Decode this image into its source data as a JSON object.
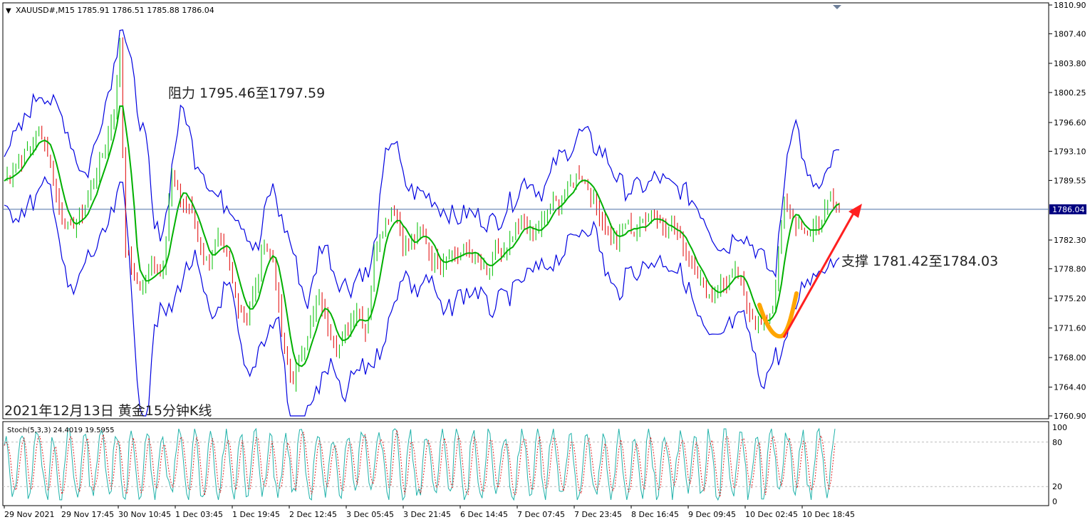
{
  "symbol_header": {
    "marker": "▼",
    "text": "XAUUSD#,M15  1785.91 1786.51 1785.88 1786.04"
  },
  "annotations": {
    "resistance": "阻力 1795.46至1797.59",
    "support": "支撑 1781.42至1784.03",
    "caption": "2021年12月13日 黄金15分钟K线"
  },
  "price_axis": {
    "ticks": [
      "1810.90",
      "1807.40",
      "1803.80",
      "1800.25",
      "1796.60",
      "1793.10",
      "1789.55",
      "1786.04",
      "1782.30",
      "1778.80",
      "1775.20",
      "1771.60",
      "1768.00",
      "1764.40",
      "1760.90"
    ],
    "current_price": "1786.04",
    "current_price_color": "#000080"
  },
  "stoch": {
    "label": "Stoch(5,3,3) 24.4019 19.5955",
    "levels": [
      "100",
      "80",
      "20",
      "0"
    ],
    "main_color": "#20b2aa",
    "signal_color": "#e02020"
  },
  "time_axis": {
    "labels": [
      "29 Nov 2021",
      "29 Nov 17:45",
      "30 Nov 10:45",
      "1 Dec 03:45",
      "1 Dec 19:45",
      "2 Dec 12:45",
      "3 Dec 05:45",
      "3 Dec 21:45",
      "6 Dec 14:45",
      "7 Dec 07:45",
      "7 Dec 23:45",
      "8 Dec 16:45",
      "9 Dec 09:45",
      "10 Dec 02:45",
      "10 Dec 18:45"
    ]
  },
  "colors": {
    "band": "#0000e0",
    "ma": "#00b000",
    "candle_up": "#00c000",
    "candle_down": "#e00000",
    "arrow": "#ff2020",
    "swing": "#ffa500",
    "axis_text": "#000000"
  },
  "chart_data": {
    "type": "candlestick",
    "title": "XAUUSD#,M15",
    "ylim": [
      1760.9,
      1810.9
    ],
    "path_close": [
      [
        0,
        1789.5
      ],
      [
        2,
        1792.5
      ],
      [
        4,
        1795.5
      ],
      [
        5,
        1791.5
      ],
      [
        6,
        1785.5
      ],
      [
        7,
        1783.5
      ],
      [
        8,
        1785
      ],
      [
        9,
        1787
      ],
      [
        10,
        1791
      ],
      [
        11,
        1794
      ],
      [
        12,
        1799.5
      ],
      [
        12.5,
        1807
      ],
      [
        13,
        1782
      ],
      [
        14,
        1777.5
      ],
      [
        15,
        1776.5
      ],
      [
        16,
        1779.5
      ],
      [
        17,
        1778
      ],
      [
        18,
        1790
      ],
      [
        19,
        1787
      ],
      [
        20,
        1786.5
      ],
      [
        21,
        1781.5
      ],
      [
        22,
        1779.5
      ],
      [
        23,
        1782.5
      ],
      [
        24,
        1780
      ],
      [
        25,
        1775
      ],
      [
        26,
        1773
      ],
      [
        27,
        1776
      ],
      [
        28,
        1782
      ],
      [
        29,
        1780
      ],
      [
        30,
        1769.5
      ],
      [
        31,
        1765
      ],
      [
        32,
        1768.5
      ],
      [
        33,
        1772
      ],
      [
        34,
        1775.5
      ],
      [
        35,
        1771.5
      ],
      [
        36,
        1769
      ],
      [
        37,
        1772
      ],
      [
        38,
        1774
      ],
      [
        39,
        1771
      ],
      [
        40,
        1782
      ],
      [
        41,
        1784.5
      ],
      [
        42,
        1786
      ],
      [
        43,
        1782
      ],
      [
        44,
        1781.5
      ],
      [
        45,
        1784
      ],
      [
        46,
        1780
      ],
      [
        47,
        1779.5
      ],
      [
        48,
        1781
      ],
      [
        49,
        1780
      ],
      [
        50,
        1781.5
      ],
      [
        51,
        1779.5
      ],
      [
        52,
        1778
      ],
      [
        53,
        1781
      ],
      [
        54,
        1780.5
      ],
      [
        55,
        1783
      ],
      [
        56,
        1784.5
      ],
      [
        57,
        1782.5
      ],
      [
        58,
        1784.5
      ],
      [
        59,
        1786.5
      ],
      [
        60,
        1787
      ],
      [
        61,
        1789
      ],
      [
        62,
        1790.5
      ],
      [
        63,
        1788.5
      ],
      [
        64,
        1786
      ],
      [
        65,
        1783
      ],
      [
        66,
        1782
      ],
      [
        67,
        1784.5
      ],
      [
        68,
        1783
      ],
      [
        69,
        1785
      ],
      [
        70,
        1785.5
      ],
      [
        71,
        1784
      ],
      [
        72,
        1784
      ],
      [
        73,
        1782
      ],
      [
        74,
        1780
      ],
      [
        75,
        1777.5
      ],
      [
        76,
        1775.5
      ],
      [
        77,
        1776.5
      ],
      [
        78,
        1777.5
      ],
      [
        79,
        1778.5
      ],
      [
        80,
        1774.5
      ],
      [
        81,
        1772.5
      ],
      [
        82,
        1772
      ],
      [
        83,
        1775
      ],
      [
        84,
        1787
      ],
      [
        85,
        1785
      ],
      [
        86,
        1783
      ],
      [
        87,
        1783.5
      ],
      [
        88,
        1784.5
      ],
      [
        89,
        1787.5
      ],
      [
        90,
        1786
      ]
    ],
    "band_width": 4.5,
    "stoch_period_bars": 90
  }
}
